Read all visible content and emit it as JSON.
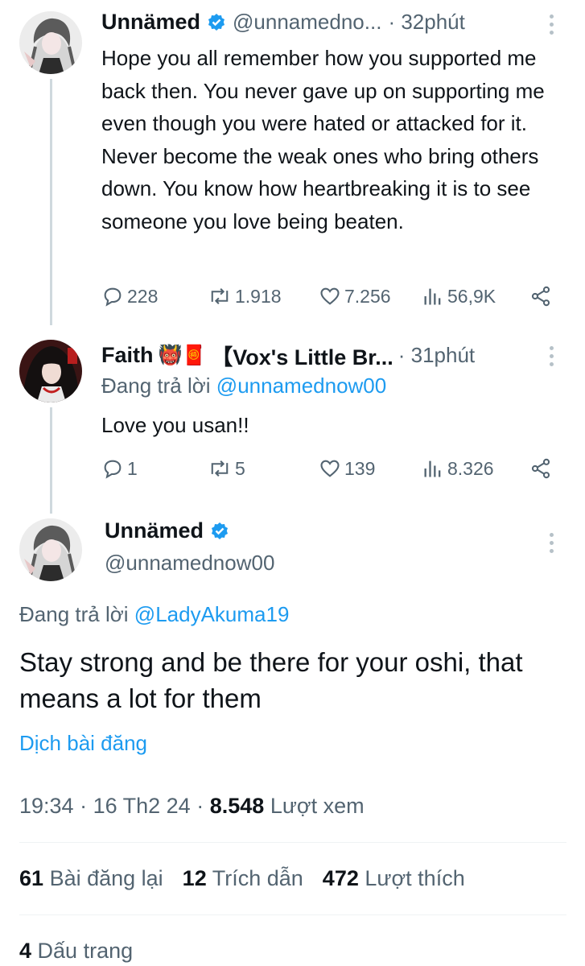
{
  "tweet1": {
    "author_name": "Unnämed",
    "handle": "@unnamedno...",
    "time": "· 32phút",
    "text": "Hope you all remember how you supported me back then. You never gave up on supporting me even though you were hated or attacked for it. Never become the weak ones who bring others down. You know how heartbreaking it is to see someone you love being beaten.",
    "replies": "228",
    "reposts": "1.918",
    "likes": "7.256",
    "views": "56,9K"
  },
  "tweet2": {
    "author_name": "Faith",
    "emoji": "👹🧧",
    "name_suffix": "【Vox's Little Br...",
    "time": "· 31phút",
    "replying_label": "Đang trả lời",
    "replying_to": "@unnamednow00",
    "text": "Love you usan!!",
    "replies": "1",
    "reposts": "5",
    "likes": "139",
    "views": "8.326"
  },
  "main_tweet": {
    "author_name": "Unnämed",
    "handle": "@unnamednow00",
    "replying_label": "Đang trả lời",
    "replying_to": "@LadyAkuma19",
    "text": "Stay strong and be there for your oshi, that means a lot for them",
    "translate": "Dịch bài đăng",
    "time": "19:34",
    "date": "16 Th2 24",
    "views_count": "8.548",
    "views_label": "Lượt xem",
    "reposts_count": "61",
    "reposts_label": "Bài đăng lại",
    "quotes_count": "12",
    "quotes_label": "Trích dẫn",
    "likes_count": "472",
    "likes_label": "Lượt thích",
    "bookmarks_count": "4",
    "bookmarks_label": "Dấu trang"
  },
  "colors": {
    "verified": "#1d9bf0",
    "link": "#1d9bf0",
    "muted": "#536471"
  }
}
